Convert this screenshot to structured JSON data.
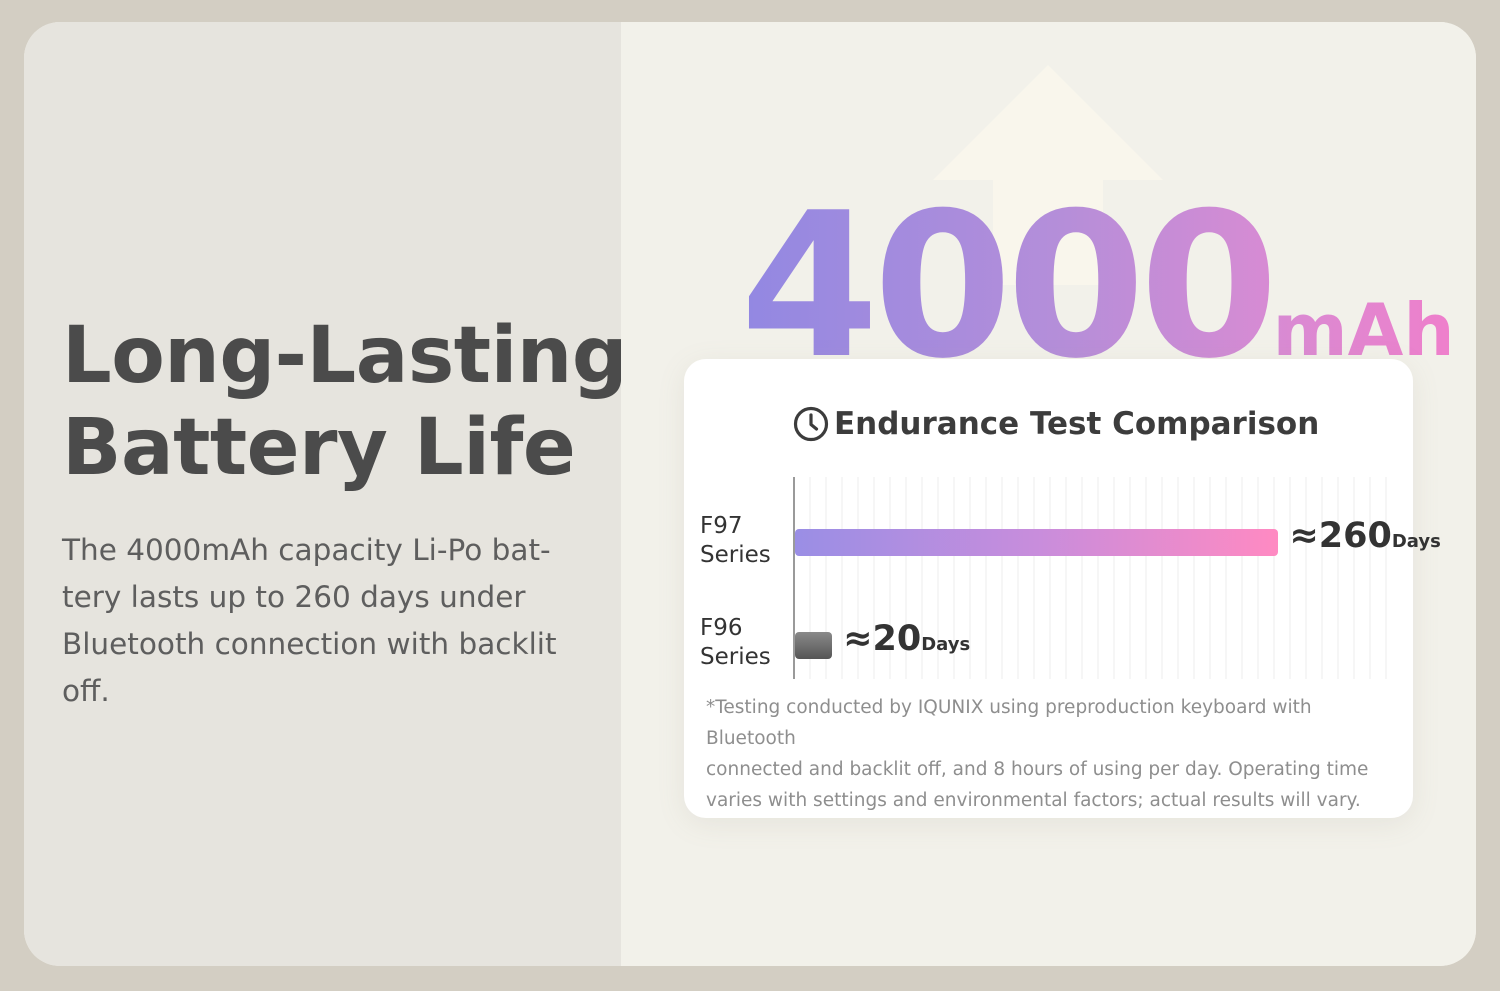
{
  "headline": {
    "line1": "Long-Lasting",
    "line2": "Battery Life"
  },
  "description": "The 4000mAh capacity Li-Po bat-\ntery lasts up to 260 days under\nBluetooth connection with backlit\noff.",
  "capacity": {
    "number": "4000",
    "unit": "mAh"
  },
  "card": {
    "title": "Endurance Test Comparison",
    "icon": "clock-icon",
    "footnote": "*Testing conducted by IQUNIX using preproduction keyboard with Bluetooth\nconnected and backlit off, and 8 hours of using per day. Operating time\nvaries with settings and environmental factors; actual results will vary."
  },
  "chart_data": {
    "type": "bar",
    "orientation": "horizontal",
    "title": "Endurance Test Comparison",
    "categories": [
      "F97\nSeries",
      "F96\nSeries"
    ],
    "values": [
      260,
      20
    ],
    "value_labels": [
      "≈260",
      "≈20"
    ],
    "unit": "Days",
    "xlim": [
      0,
      320
    ],
    "grid": true,
    "colors": [
      "#b08de0",
      "#6a6a6a"
    ]
  },
  "colors": {
    "accent_start": "#9288e2",
    "accent_end": "#ef7fcb",
    "text_dark": "#4b4b4b"
  }
}
